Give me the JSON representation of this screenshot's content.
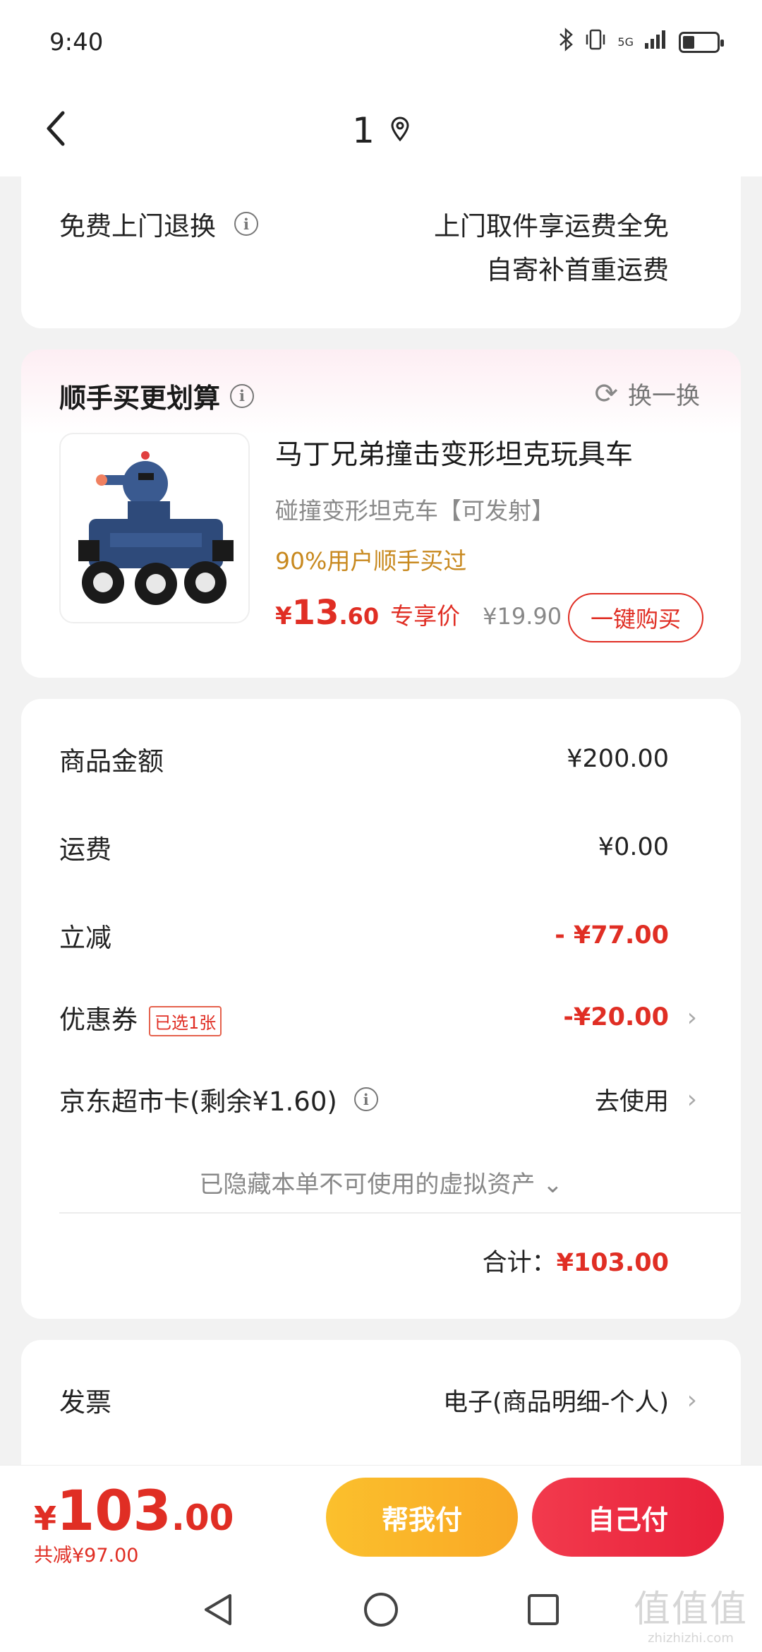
{
  "status_bar": {
    "time": "9:40",
    "signal_text": "5G"
  },
  "nav": {
    "title": "1"
  },
  "return_service": {
    "label": "免费上门退换",
    "line1": "上门取件享运费全免",
    "line2": "自寄补首重运费"
  },
  "recommend": {
    "title": "顺手买更划算",
    "refresh_label": "换一换",
    "product": {
      "name": "马丁兄弟撞击变形坦克玩具车",
      "subtitle": "碰撞变形坦克车【可发射】",
      "tag": "90%用户顺手买过",
      "price_symbol": "¥",
      "price_int": "13",
      "price_dec": ".60",
      "price_label": "专享价",
      "original_price": "¥19.90",
      "buy_label": "一键购买"
    }
  },
  "summary": {
    "goods_amount_label": "商品金额",
    "goods_amount": "¥200.00",
    "shipping_label": "运费",
    "shipping": "¥0.00",
    "discount_label": "立减",
    "discount": "- ¥77.00",
    "coupon_label": "优惠券",
    "coupon_badge": "已选1张",
    "coupon_value": "-¥20.00",
    "card_label": "京东超市卡(剩余¥1.60)",
    "card_action": "去使用",
    "hidden_note": "已隐藏本单不可使用的虚拟资产",
    "total_label": "合计：",
    "total_value": "¥103.00"
  },
  "invoice": {
    "label": "发票",
    "value": "电子(商品明细-个人)"
  },
  "bottom": {
    "price_symbol": "¥",
    "price_int": "103",
    "price_dec": ".00",
    "discount_text": "共减¥97.00",
    "help_pay_label": "帮我付",
    "self_pay_label": "自己付"
  },
  "watermark": {
    "logo": "值值值",
    "url": "zhizhizhi.com"
  },
  "colors": {
    "accent_red": "#e02e24",
    "gold": "#c8891f",
    "help_yellow": "#fbc02d"
  }
}
